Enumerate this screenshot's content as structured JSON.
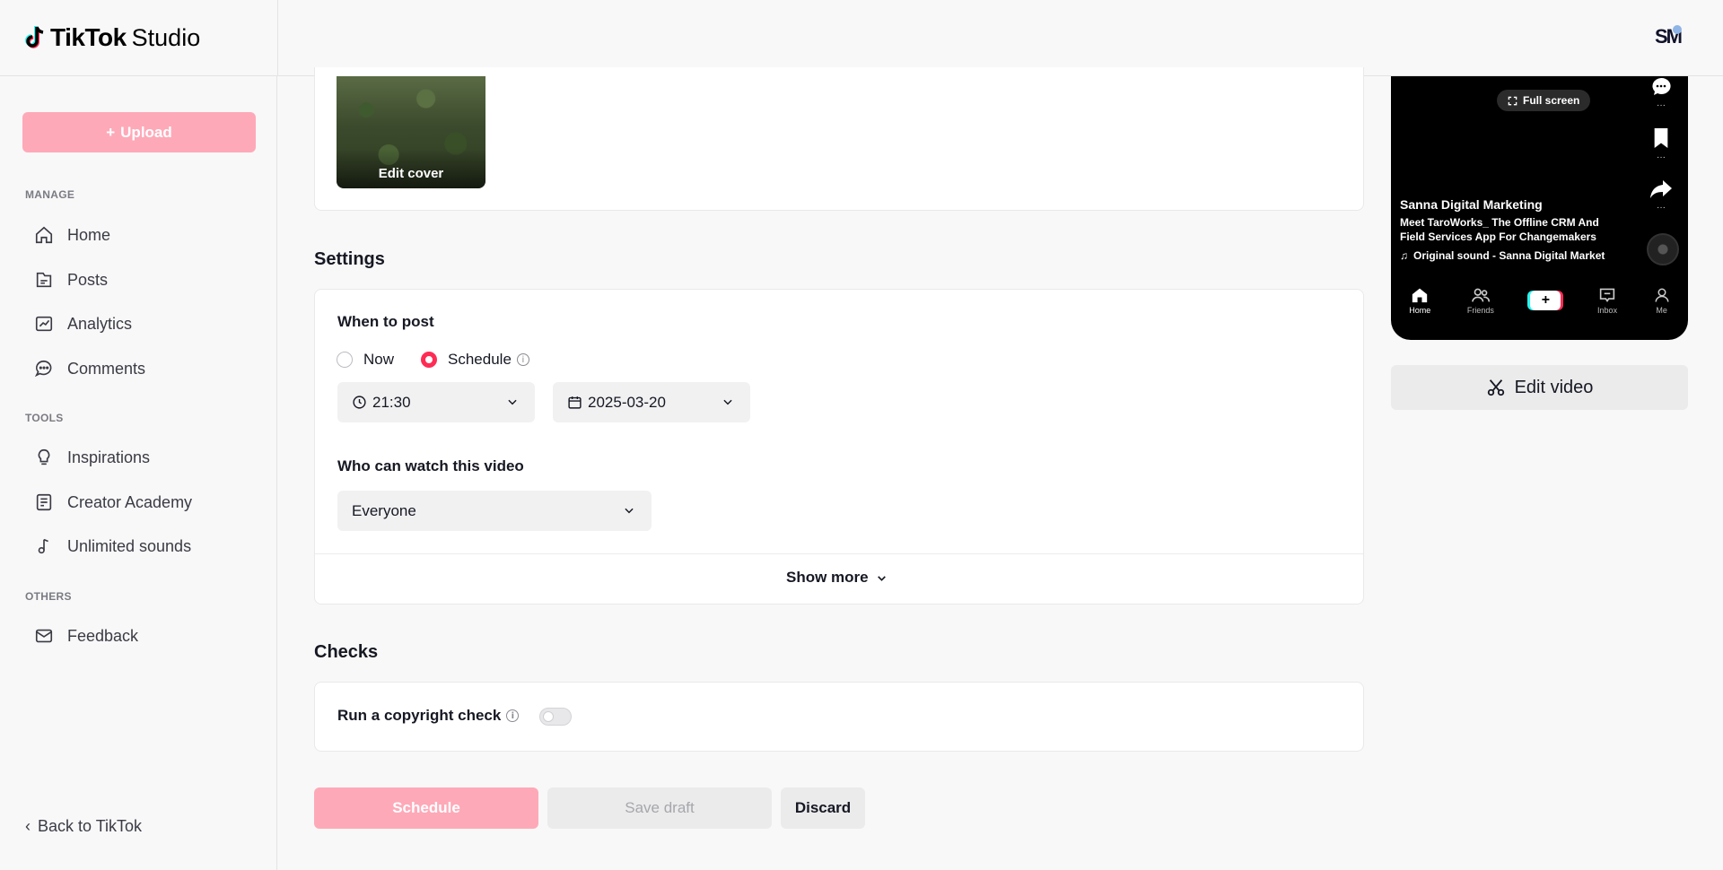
{
  "header": {
    "brand": "TikTok",
    "brand_suffix": "Studio",
    "avatar_initials": "SM"
  },
  "sidebar": {
    "upload_label": "Upload",
    "sections": {
      "manage": "MANAGE",
      "tools": "TOOLS",
      "others": "OTHERS"
    },
    "items": [
      {
        "label": "Home",
        "icon": "home-icon"
      },
      {
        "label": "Posts",
        "icon": "posts-icon"
      },
      {
        "label": "Analytics",
        "icon": "analytics-icon"
      },
      {
        "label": "Comments",
        "icon": "comments-icon"
      },
      {
        "label": "Inspirations",
        "icon": "lightbulb-icon"
      },
      {
        "label": "Creator Academy",
        "icon": "academy-icon"
      },
      {
        "label": "Unlimited sounds",
        "icon": "music-note-icon"
      },
      {
        "label": "Feedback",
        "icon": "mail-icon"
      }
    ],
    "back_label": "Back to TikTok"
  },
  "cover": {
    "edit_label": "Edit cover"
  },
  "settings": {
    "title": "Settings",
    "when_label": "When to post",
    "now_label": "Now",
    "schedule_label": "Schedule",
    "selected": "Schedule",
    "time_value": "21:30",
    "date_value": "2025-03-20",
    "who_label": "Who can watch this video",
    "audience_value": "Everyone",
    "show_more_label": "Show more"
  },
  "checks": {
    "title": "Checks",
    "copyright_label": "Run a copyright check",
    "copyright_enabled": false
  },
  "actions": {
    "schedule_label": "Schedule",
    "save_draft_label": "Save draft",
    "discard_label": "Discard"
  },
  "preview": {
    "fullscreen_label": "Full screen",
    "author": "Sanna Digital Marketing",
    "description": "Meet TaroWorks_ The Offline CRM And Field Services App For Changemakers",
    "sound": "Original sound - Sanna Digital Market",
    "nav": [
      "Home",
      "Friends",
      "Inbox",
      "Me"
    ],
    "edit_video_label": "Edit video"
  },
  "colors": {
    "accent": "#fe2c55",
    "accent_disabled": "#fea9b8"
  }
}
